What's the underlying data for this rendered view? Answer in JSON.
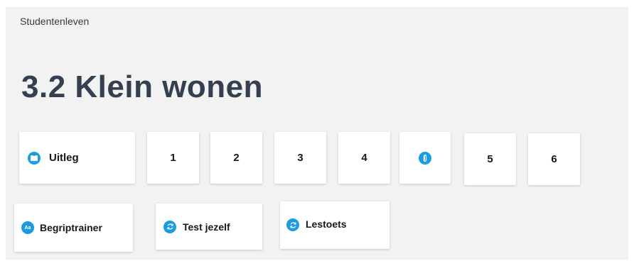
{
  "breadcrumb": "Studentenleven",
  "title": "3.2 Klein wonen",
  "cards": {
    "uitleg": {
      "label": "Uitleg",
      "icon": "book-icon"
    },
    "page1": "1",
    "page2": "2",
    "page3": "3",
    "page4": "4",
    "attachment": {
      "icon": "paperclip-icon"
    },
    "page5": "5",
    "page6": "6",
    "begriptrainer": {
      "label": "Begriptrainer",
      "icon_text": "Aa"
    },
    "testjezelf": {
      "label": "Test jezelf",
      "icon": "refresh-icon"
    },
    "lestoets": {
      "label": "Lestoets",
      "icon": "refresh-icon"
    }
  },
  "colors": {
    "accent": "#1c9bdf",
    "title": "#344050",
    "panel_bg": "#f2f2f2"
  }
}
